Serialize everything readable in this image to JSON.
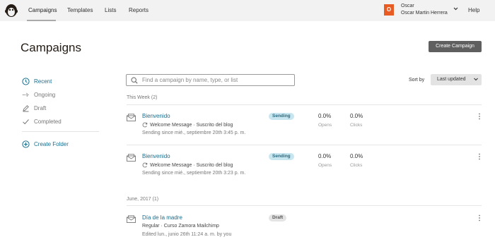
{
  "nav": {
    "items": [
      {
        "label": "Campaigns"
      },
      {
        "label": "Templates"
      },
      {
        "label": "Lists"
      },
      {
        "label": "Reports"
      }
    ],
    "account": {
      "initial": "O",
      "first_name": "Oscar",
      "full_name": "Oscar Martin Herrera"
    },
    "help": "Help"
  },
  "header": {
    "title": "Campaigns",
    "create_button": "Create Campaign"
  },
  "sidebar": {
    "items": [
      {
        "label": "Recent",
        "icon": "clock-icon"
      },
      {
        "label": "Ongoing",
        "icon": "arrow-right-icon"
      },
      {
        "label": "Draft",
        "icon": "pencil-icon"
      },
      {
        "label": "Completed",
        "icon": "check-icon"
      }
    ],
    "create_folder": "Create Folder"
  },
  "search": {
    "placeholder": "Find a campaign by name, type, or list",
    "value": ""
  },
  "sort": {
    "label": "Sort by",
    "selected": "Last updated"
  },
  "groups": [
    {
      "label": "This Week (2)",
      "campaigns": [
        {
          "name": "Bienvenido",
          "type": "Welcome Message · Suscrito del blog",
          "status_line": "Sending since mié., septiembre 20th 3:45 p. m.",
          "badge": "Sending",
          "opens_value": "0.0%",
          "opens_label": "Opens",
          "clicks_value": "0.0%",
          "clicks_label": "Clicks"
        },
        {
          "name": "Bienvenido",
          "type": "Welcome Message · Suscrito del blog",
          "status_line": "Sending since mié., septiembre 20th 3:23 p. m.",
          "badge": "Sending",
          "opens_value": "0.0%",
          "opens_label": "Opens",
          "clicks_value": "0.0%",
          "clicks_label": "Clicks"
        }
      ]
    },
    {
      "label": "June, 2017 (1)",
      "campaigns": [
        {
          "name": "Día de la madre",
          "type": "Regular · Curso Zamora Mailchimp",
          "status_line": "Edited lun., junio 26th 11:24 a. m. by you",
          "badge": "Draft"
        }
      ]
    }
  ],
  "colors": {
    "accent": "#1a6e8e",
    "nav_bg": "#f2f2f2",
    "button_dark": "#5f5f5f",
    "account_orange": "#e85c23",
    "sending_badge": "#c8e6ef",
    "draft_badge": "#e4e4e4"
  }
}
